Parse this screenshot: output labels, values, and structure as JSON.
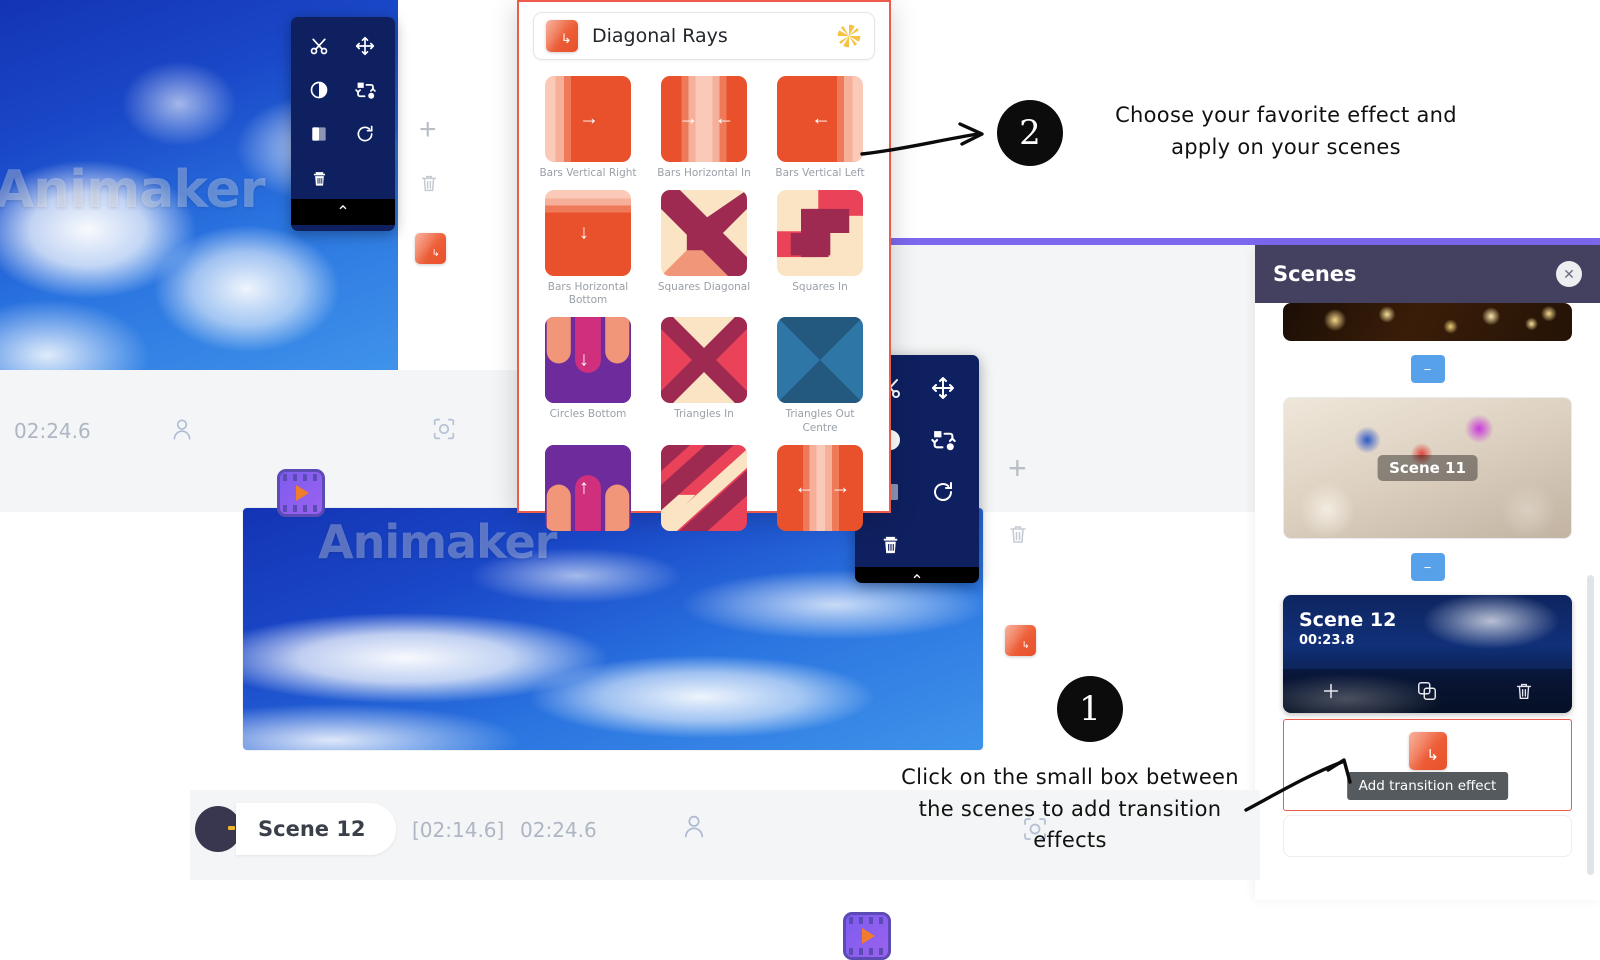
{
  "app": {
    "watermark": "Animaker",
    "purple_accent": "#7b68ee",
    "brand_orange": "#ee5b4a"
  },
  "canvas_toolbar": {
    "buttons": [
      {
        "name": "cut-icon",
        "label": "Cut"
      },
      {
        "name": "move-icon",
        "label": "Move"
      },
      {
        "name": "contrast-icon",
        "label": "Adjust"
      },
      {
        "name": "replace-icon",
        "label": "Replace"
      },
      {
        "name": "crop-icon",
        "label": "Crop"
      },
      {
        "name": "rotate-icon",
        "label": "Rotate"
      },
      {
        "name": "delete-icon",
        "label": "Delete"
      }
    ],
    "collapse_glyph": "⌃"
  },
  "effects_popup": {
    "header_title": "Diagonal Rays",
    "header_thumb_icon": "transition-thumb-icon",
    "header_right_icon": "pinwheel-icon",
    "effects": [
      {
        "label": "Bars Vertical Right",
        "arrows": [
          "→"
        ],
        "style": "bars-v-right"
      },
      {
        "label": "Bars Horizontal In",
        "arrows": [
          "→",
          "←"
        ],
        "style": "bars-h-in"
      },
      {
        "label": "Bars Vertical Left",
        "arrows": [
          "←"
        ],
        "style": "bars-v-left"
      },
      {
        "label": "Bars Horizontal Bottom",
        "arrows": [
          "↓"
        ],
        "style": "bars-h-bottom"
      },
      {
        "label": "Squares Diagonal",
        "arrows": [],
        "style": "squares-diagonal"
      },
      {
        "label": "Squares In",
        "arrows": [],
        "style": "squares-in"
      },
      {
        "label": "Circles Bottom",
        "arrows": [
          "↓"
        ],
        "style": "circles-bottom"
      },
      {
        "label": "Triangles In",
        "arrows": [],
        "style": "triangles-in"
      },
      {
        "label": "Triangles Out Centre",
        "arrows": [],
        "style": "triangles-out"
      },
      {
        "label": "",
        "arrows": [
          "↑"
        ],
        "style": "circles-top"
      },
      {
        "label": "",
        "arrows": [],
        "style": "diagonal-stripes"
      },
      {
        "label": "",
        "arrows": [
          "←",
          "→"
        ],
        "style": "bars-v-out"
      }
    ]
  },
  "scenes_panel": {
    "title": "Scenes",
    "close_glyph": "✕",
    "add_between_glyph": "−",
    "scenes": [
      {
        "name": "",
        "duration": "",
        "thumb": "bokeh"
      },
      {
        "name": "Scene 11",
        "duration": "",
        "thumb": "family"
      },
      {
        "name": "Scene 12",
        "duration": "00:23.8",
        "thumb": "sky"
      }
    ],
    "scene12_actions": [
      {
        "name": "add-scene-icon",
        "glyph": "+"
      },
      {
        "name": "duplicate-scene-icon",
        "glyph": "copy"
      },
      {
        "name": "delete-scene-icon",
        "glyph": "trash"
      }
    ],
    "transition_tooltip": "Add transition effect"
  },
  "timeline_upper": {
    "time": "02:24.6",
    "character_icon": "character-icon",
    "play_icon": "film-play-icon",
    "focus_icon": "focus-icon"
  },
  "timeline_bottom": {
    "scene_name": "Scene 12",
    "time_range": "[02:14.6]",
    "current_time": "02:24.6",
    "character_icon": "character-icon",
    "play_icon": "film-play-icon",
    "focus_icon": "focus-icon"
  },
  "annotations": [
    {
      "number": "❶",
      "text": "Click on the small box between the scenes to add transition effects"
    },
    {
      "number": "❷",
      "text": "Choose your favorite effect and apply on your scenes"
    }
  ],
  "annotation_1_number": "1",
  "annotation_1_text": "Click on the small box between the scenes to add transition effects",
  "annotation_2_number": "2",
  "annotation_2_text": "Choose your favorite effect and apply on your scenes"
}
